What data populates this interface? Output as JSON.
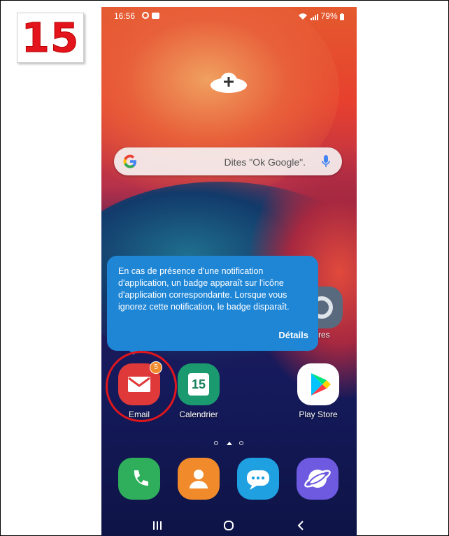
{
  "step": {
    "number": "15",
    "color": "#e3141c"
  },
  "status_bar": {
    "time": "16:56",
    "battery": "79%"
  },
  "search": {
    "placeholder": "Dites \"Ok Google\"."
  },
  "tooltip": {
    "text": "En cas de présence d'une notification d'application, un badge apparaît sur l'icône d'application correspondante. Lorsque vous ignorez cette notification, le badge disparaît.",
    "link": "Détails"
  },
  "apps": [
    {
      "label": "Email",
      "badge": "5",
      "icon": "email-icon"
    },
    {
      "label": "Calendrier",
      "day": "15",
      "icon": "calendar-icon"
    },
    {
      "label": "Play Store",
      "icon": "play-store-icon"
    }
  ],
  "settings_label_partial": "ètres",
  "dock": [
    {
      "icon": "phone-icon"
    },
    {
      "icon": "contacts-icon"
    },
    {
      "icon": "messages-icon"
    },
    {
      "icon": "internet-icon"
    }
  ],
  "colors": {
    "tooltip": "#1f86d6",
    "highlight_ring": "#e0161c",
    "badge": "#f08a2a"
  }
}
